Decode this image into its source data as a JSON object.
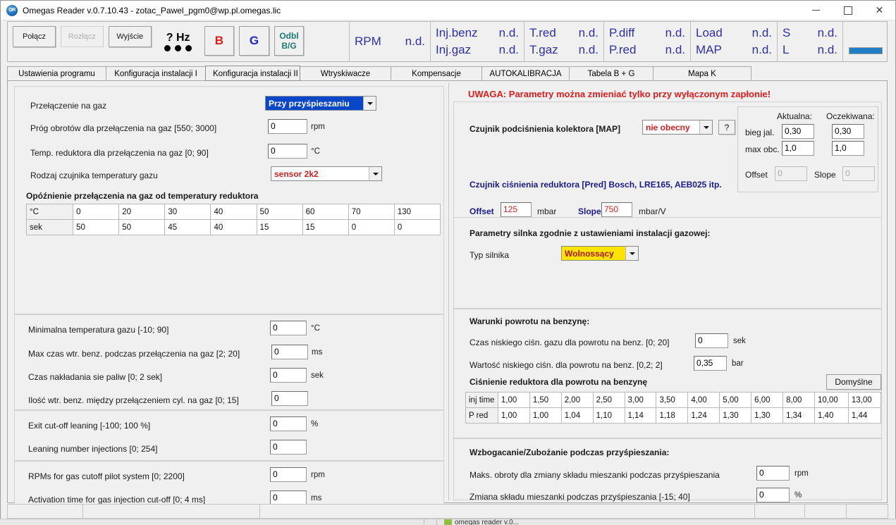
{
  "window": {
    "icon": "app-icon",
    "title": "Omegas Reader v.0.7.10.43  -  zotac_Pawel_pgm0@wp.pl.omegas.lic",
    "minimize": "–",
    "maximize": "□",
    "close": "✕"
  },
  "toolbar": {
    "connect": "Połącz",
    "disconnect": "Rozłącz",
    "exit": "Wyjście",
    "hz": "? Hz",
    "b_button": "B",
    "g_button": "G",
    "odbl_line1": "Odbl",
    "odbl_line2": "B/G",
    "gauges": [
      {
        "label": "RPM",
        "value": "n.d."
      },
      {
        "label2": "Inj.benz",
        "value2": "n.d.",
        "label3": "Inj.gaz",
        "value3": "n.d."
      },
      {
        "label2": "T.red",
        "value2": "n.d.",
        "label3": "T.gaz",
        "value3": "n.d."
      },
      {
        "label2": "P.diff",
        "value2": "n.d.",
        "label3": "P.red",
        "value3": "n.d."
      },
      {
        "label2": "Load",
        "value2": "n.d.",
        "label3": "MAP",
        "value3": "n.d."
      },
      {
        "label2": "S",
        "value2": "n.d.",
        "label3": "L",
        "value3": "n.d."
      }
    ]
  },
  "tabs": [
    {
      "label": "Ustawienia programu",
      "selected": false
    },
    {
      "label": "Konfiguracja instalacji I",
      "selected": false
    },
    {
      "label": "Konfiguracja instalacji II",
      "selected": true
    },
    {
      "label": "Wtryskiwacze",
      "selected": false
    },
    {
      "label": "Kompensacje",
      "selected": false
    },
    {
      "label": "AUTOKALIBRACJA",
      "selected": false
    },
    {
      "label": "Tabela B + G",
      "selected": false
    },
    {
      "label": "Mapa K",
      "selected": false
    }
  ],
  "left": {
    "switch_to_gas_label": "Przełączenie na gaz",
    "switch_to_gas_value": "Przy przyśpieszaniu",
    "rpm_threshold_label": "Próg obrotów dla przełączenia na gaz [550; 3000]",
    "rpm_threshold_value": "0",
    "rpm_threshold_unit": "rpm",
    "reducer_temp_label": "Temp. reduktora dla przełączenia na gaz [0; 90]",
    "reducer_temp_value": "0",
    "reducer_temp_unit": "°C",
    "gas_sensor_label": "Rodzaj czujnika temperatury gazu",
    "gas_sensor_value": "sensor 2k2",
    "delay_table_title": "Opóźnienie przełączenia na gaz od temperatury reduktora",
    "delay_table": {
      "row1_header": "°C",
      "row1": [
        "0",
        "20",
        "30",
        "40",
        "50",
        "60",
        "70",
        "130"
      ],
      "row2_header": "sek",
      "row2": [
        "50",
        "50",
        "45",
        "40",
        "15",
        "15",
        "0",
        "0"
      ]
    },
    "min_gas_temp_label": "Minimalna temperatura gazu [-10; 90]",
    "min_gas_temp_value": "0",
    "min_gas_temp_unit": "°C",
    "max_petrol_time_label": "Max czas wtr. benz. podczas przełączenia na gaz [2; 20]",
    "max_petrol_time_value": "0",
    "max_petrol_time_unit": "ms",
    "overlap_label": "Czas nakładania sie paliw [0; 2 sek]",
    "overlap_value": "0",
    "overlap_unit": "sek",
    "injections_between_label": "Ilość wtr. benz. między przełączeniem cyl. na gaz [0; 15]",
    "injections_between_value": "0",
    "exit_cutoff_label": "Exit cut-off leaning [-100; 100 %]",
    "exit_cutoff_value": "0",
    "exit_cutoff_unit": "%",
    "leaning_inj_label": "Leaning number injections [0; 254]",
    "leaning_inj_value": "0",
    "rpm_cutoff_label": "RPMs for gas cutoff pilot system [0; 2200]",
    "rpm_cutoff_value": "0",
    "rpm_cutoff_unit": "rpm",
    "activation_time_label": "Activation time for gas injection cut-off [0; 4 ms]",
    "activation_time_value": "0",
    "activation_time_unit": "ms"
  },
  "right": {
    "warning": "UWAGA: Parametry można zmieniać tylko przy wyłączonym zapłonie!",
    "map_sensor_label": "Czujnik podciśnienia kolektora [MAP]",
    "map_sensor_value": "nie obecny",
    "help_button": "?",
    "col_actual": "Aktualna:",
    "col_expected": "Oczekiwana:",
    "idle_label": "bieg jal.",
    "idle_actual": "0,30",
    "idle_expected": "0,30",
    "maxload_label": "max obc.",
    "maxload_actual": "1,0",
    "maxload_expected": "1,0",
    "map_offset_label": "Offset",
    "map_offset_value": "0",
    "map_slope_label": "Slope",
    "map_slope_value": "0",
    "reducer_sensor_label": "Czujnik ciśnienia reduktora [Pred] Bosch, LRE165, AEB025 itp.",
    "offset_label": "Offset",
    "offset_value": "125",
    "offset_unit": "mbar",
    "slope_label": "Slope",
    "slope_value": "750",
    "slope_unit": "mbar/V",
    "engine_params_title": "Parametry silnka zgodnie z ustawieniami instalacji gazowej:",
    "engine_type_label": "Typ silnika",
    "engine_type_value": "Wolnossący",
    "return_title": "Warunki powrotu na benzynę:",
    "low_press_time_label": "Czas niskiego ciśn. gazu dla powrotu na benz. [0; 20]",
    "low_press_time_value": "0",
    "low_press_time_unit": "sek",
    "low_press_val_label": "Wartość niskiego ciśn. dla powrotu na benz. [0,2; 2]",
    "low_press_val_value": "0,35",
    "low_press_val_unit": "bar",
    "pressure_table_title": "Ciśnienie reduktora dla powrotu na benzynę",
    "default_button": "Domyślne",
    "pressure_table": {
      "row1_header": "inj time",
      "row1": [
        "1,00",
        "1,50",
        "2,00",
        "2,50",
        "3,00",
        "3,50",
        "4,00",
        "5,00",
        "6,00",
        "8,00",
        "10,00",
        "13,00"
      ],
      "row2_header": "P red",
      "row2": [
        "1,00",
        "1,00",
        "1,04",
        "1,10",
        "1,14",
        "1,18",
        "1,24",
        "1,30",
        "1,30",
        "1,34",
        "1,40",
        "1,44"
      ]
    },
    "enrich_title": "Wzbogacanie/Zubożanie podczas przyśpieszania:",
    "max_rpm_label": "Maks. obroty dla zmiany składu mieszanki podczas przyśpieszania",
    "max_rpm_value": "0",
    "max_rpm_unit": "rpm",
    "mix_change_label": "Zmiana składu mieszanki podczas przyśpieszania [-15; 40]",
    "mix_change_value": "0",
    "mix_change_unit": "%"
  },
  "taskbar": {
    "item": "omegas reader v.0..."
  }
}
